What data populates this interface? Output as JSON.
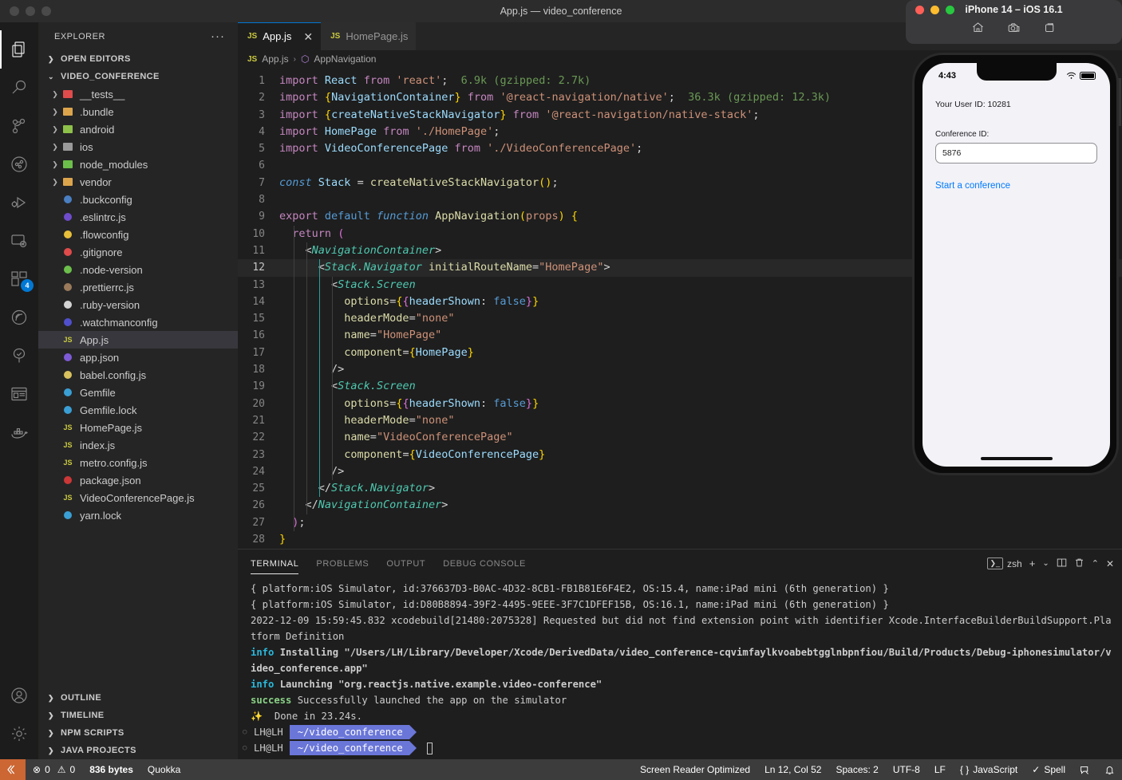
{
  "window": {
    "title": "App.js — video_conference"
  },
  "activity_bar": {
    "items": [
      {
        "name": "explorer",
        "icon": "files-icon",
        "active": true,
        "badge": null
      },
      {
        "name": "search",
        "icon": "search-icon",
        "active": false,
        "badge": null
      },
      {
        "name": "source-control",
        "icon": "source-control-icon",
        "active": false,
        "badge": null
      },
      {
        "name": "testing",
        "icon": "beaker-icon",
        "active": false,
        "badge": null
      },
      {
        "name": "run-and-debug",
        "icon": "run-debug-icon",
        "active": false,
        "badge": null
      },
      {
        "name": "remote-explorer",
        "icon": "remote-explorer-icon",
        "active": false,
        "badge": null
      },
      {
        "name": "extensions",
        "icon": "extensions-icon",
        "active": false,
        "badge": "4"
      },
      {
        "name": "sonarlint",
        "icon": "sonarlint-icon",
        "active": false,
        "badge": null
      },
      {
        "name": "test-tree",
        "icon": "tree-check-icon",
        "active": false,
        "badge": null
      },
      {
        "name": "browser-preview",
        "icon": "browser-preview-icon",
        "active": false,
        "badge": null
      },
      {
        "name": "docker",
        "icon": "docker-whale-icon",
        "active": false,
        "badge": null
      }
    ],
    "bottom_items": [
      {
        "name": "accounts",
        "icon": "account-icon"
      },
      {
        "name": "settings",
        "icon": "gear-icon"
      }
    ]
  },
  "sidebar": {
    "header": "EXPLORER",
    "more_actions": "···",
    "sections": [
      {
        "label": "OPEN EDITORS",
        "expanded": false
      },
      {
        "label": "VIDEO_CONFERENCE",
        "expanded": true
      }
    ],
    "tree": [
      {
        "label": "__tests__",
        "type": "folder",
        "icon_color": "#e04b4b",
        "expandable": true,
        "selected": false
      },
      {
        "label": ".bundle",
        "type": "folder",
        "icon_color": "#dca54c",
        "expandable": true,
        "selected": false
      },
      {
        "label": "android",
        "type": "folder",
        "icon_color": "#8dc149",
        "expandable": true,
        "selected": false
      },
      {
        "label": "ios",
        "type": "folder",
        "icon_color": "#9a9a9a",
        "expandable": true,
        "selected": false
      },
      {
        "label": "node_modules",
        "type": "folder",
        "icon_color": "#6cbf4b",
        "expandable": true,
        "selected": false
      },
      {
        "label": "vendor",
        "type": "folder",
        "icon_color": "#dca54c",
        "expandable": true,
        "selected": false
      },
      {
        "label": ".buckconfig",
        "type": "file",
        "icon_color": "#4a7fc1",
        "expandable": false,
        "selected": false
      },
      {
        "label": ".eslintrc.js",
        "type": "file",
        "icon_color": "#6f4ccc",
        "expandable": false,
        "selected": false
      },
      {
        "label": ".flowconfig",
        "type": "file",
        "icon_color": "#e8bf3a",
        "expandable": false,
        "selected": false
      },
      {
        "label": ".gitignore",
        "type": "file",
        "icon_color": "#e04b4b",
        "expandable": false,
        "selected": false
      },
      {
        "label": ".node-version",
        "type": "file",
        "icon_color": "#6cbf4b",
        "expandable": false,
        "selected": false
      },
      {
        "label": ".prettierrc.js",
        "type": "file",
        "icon_color": "#9a7a5a",
        "expandable": false,
        "selected": false
      },
      {
        "label": ".ruby-version",
        "type": "file",
        "icon_color": "#d4d4d4",
        "expandable": false,
        "selected": false
      },
      {
        "label": ".watchmanconfig",
        "type": "file",
        "icon_color": "#5050cc",
        "expandable": false,
        "selected": false
      },
      {
        "label": "App.js",
        "type": "js",
        "icon_color": "#cbcb41",
        "expandable": false,
        "selected": true
      },
      {
        "label": "app.json",
        "type": "file",
        "icon_color": "#7e5bd6",
        "expandable": false,
        "selected": false
      },
      {
        "label": "babel.config.js",
        "type": "file",
        "icon_color": "#d8c15e",
        "expandable": false,
        "selected": false
      },
      {
        "label": "Gemfile",
        "type": "file",
        "icon_color": "#3a9fd4",
        "expandable": false,
        "selected": false
      },
      {
        "label": "Gemfile.lock",
        "type": "file",
        "icon_color": "#3a9fd4",
        "expandable": false,
        "selected": false
      },
      {
        "label": "HomePage.js",
        "type": "js",
        "icon_color": "#cbcb41",
        "expandable": false,
        "selected": false
      },
      {
        "label": "index.js",
        "type": "js",
        "icon_color": "#cbcb41",
        "expandable": false,
        "selected": false
      },
      {
        "label": "metro.config.js",
        "type": "js",
        "icon_color": "#cbcb41",
        "expandable": false,
        "selected": false
      },
      {
        "label": "package.json",
        "type": "file",
        "icon_color": "#cb3837",
        "expandable": false,
        "selected": false
      },
      {
        "label": "VideoConferencePage.js",
        "type": "js",
        "icon_color": "#cbcb41",
        "expandable": false,
        "selected": false
      },
      {
        "label": "yarn.lock",
        "type": "file",
        "icon_color": "#3a9fd4",
        "expandable": false,
        "selected": false
      }
    ],
    "bottom_sections": [
      {
        "label": "OUTLINE"
      },
      {
        "label": "TIMELINE"
      },
      {
        "label": "NPM SCRIPTS"
      },
      {
        "label": "JAVA PROJECTS"
      }
    ]
  },
  "editor": {
    "tabs": [
      {
        "label": "App.js",
        "active": true,
        "badge": "JS",
        "closable": true
      },
      {
        "label": "HomePage.js",
        "active": false,
        "badge": "JS",
        "closable": false
      }
    ],
    "close_glyph": "✕",
    "breadcrumb": {
      "file_badge": "JS",
      "file": "App.js",
      "separator": "›",
      "symbol": "AppNavigation"
    },
    "total_lines": 28,
    "current_line": 12,
    "code_lines": [
      {
        "n": 1,
        "html": "<span class='k'>import</span> <span class='id'>React</span> <span class='k'>from</span> <span class='str'>'react'</span><span class='pun'>;</span>  <span class='ann'>6.9k (gzipped: 2.7k)</span>"
      },
      {
        "n": 2,
        "html": "<span class='k'>import</span> <span class='br1'>{</span><span class='id'>NavigationContainer</span><span class='br1'>}</span> <span class='k'>from</span> <span class='str'>'@react-navigation/native'</span><span class='pun'>;</span>  <span class='ann'>36.3k (gzipped: 12.3k)</span>"
      },
      {
        "n": 3,
        "html": "<span class='k'>import</span> <span class='br1'>{</span><span class='id'>createNativeStackNavigator</span><span class='br1'>}</span> <span class='k'>from</span> <span class='str'>'@react-navigation/native-stack'</span><span class='pun'>;</span>"
      },
      {
        "n": 4,
        "html": "<span class='k'>import</span> <span class='id'>HomePage</span> <span class='k'>from</span> <span class='str'>'./HomePage'</span><span class='pun'>;</span>"
      },
      {
        "n": 5,
        "html": "<span class='k'>import</span> <span class='id'>VideoConferencePage</span> <span class='k'>from</span> <span class='str'>'./VideoConferencePage'</span><span class='pun'>;</span>"
      },
      {
        "n": 6,
        "html": ""
      },
      {
        "n": 7,
        "html": "<span class='kwi'>const</span> <span class='id'>Stack</span> <span class='pun'>=</span> <span class='fn'>createNativeStackNavigator</span><span class='br1'>()</span><span class='pun'>;</span>"
      },
      {
        "n": 8,
        "html": ""
      },
      {
        "n": 9,
        "html": "<span class='k'>export</span> <span class='kw'>default</span> <span class='kwi'>function</span> <span class='fn'>AppNavigation</span><span class='br1'>(</span><span class='str'>props</span><span class='br1'>)</span> <span class='br1'>{</span>"
      },
      {
        "n": 10,
        "html": "  <span class='k'>return</span> <span class='br2'>(</span>"
      },
      {
        "n": 11,
        "html": "    <span class='pun'>&lt;</span><span class='tag'>NavigationContainer</span><span class='pun'>&gt;</span>"
      },
      {
        "n": 12,
        "html": "      <span class='pun'>&lt;</span><span class='tag'>Stack.Navigator</span> <span class='prop'>initialRouteName</span><span class='pun'>=</span><span class='str'>\"HomePage\"</span><span class='pun'>&gt;</span>"
      },
      {
        "n": 13,
        "html": "        <span class='pun'>&lt;</span><span class='tag'>Stack.Screen</span>"
      },
      {
        "n": 14,
        "html": "          <span class='prop'>options</span><span class='pun'>=</span><span class='br1'>{</span><span class='br2'>{</span><span class='id'>headerShown</span><span class='pun'>: </span><span class='lit'>false</span><span class='br2'>}</span><span class='br1'>}</span>"
      },
      {
        "n": 15,
        "html": "          <span class='prop'>headerMode</span><span class='pun'>=</span><span class='str'>\"none\"</span>"
      },
      {
        "n": 16,
        "html": "          <span class='prop'>name</span><span class='pun'>=</span><span class='str'>\"HomePage\"</span>"
      },
      {
        "n": 17,
        "html": "          <span class='prop'>component</span><span class='pun'>=</span><span class='br1'>{</span><span class='id'>HomePage</span><span class='br1'>}</span>"
      },
      {
        "n": 18,
        "html": "        <span class='pun'>/&gt;</span>"
      },
      {
        "n": 19,
        "html": "        <span class='pun'>&lt;</span><span class='tag'>Stack.Screen</span>"
      },
      {
        "n": 20,
        "html": "          <span class='prop'>options</span><span class='pun'>=</span><span class='br1'>{</span><span class='br2'>{</span><span class='id'>headerShown</span><span class='pun'>: </span><span class='lit'>false</span><span class='br2'>}</span><span class='br1'>}</span>"
      },
      {
        "n": 21,
        "html": "          <span class='prop'>headerMode</span><span class='pun'>=</span><span class='str'>\"none\"</span>"
      },
      {
        "n": 22,
        "html": "          <span class='prop'>name</span><span class='pun'>=</span><span class='str'>\"VideoConferencePage\"</span>"
      },
      {
        "n": 23,
        "html": "          <span class='prop'>component</span><span class='pun'>=</span><span class='br1'>{</span><span class='id'>VideoConferencePage</span><span class='br1'>}</span>"
      },
      {
        "n": 24,
        "html": "        <span class='pun'>/&gt;</span>"
      },
      {
        "n": 25,
        "html": "      <span class='pun'>&lt;/</span><span class='tag'>Stack.Navigator</span><span class='pun'>&gt;</span>"
      },
      {
        "n": 26,
        "html": "    <span class='pun'>&lt;/</span><span class='tag'>NavigationContainer</span><span class='pun'>&gt;</span>"
      },
      {
        "n": 27,
        "html": "  <span class='br2'>)</span><span class='pun'>;</span>"
      },
      {
        "n": 28,
        "html": "<span class='br1'>}</span>"
      }
    ]
  },
  "panel": {
    "tabs": [
      {
        "label": "TERMINAL",
        "active": true
      },
      {
        "label": "PROBLEMS",
        "active": false
      },
      {
        "label": "OUTPUT",
        "active": false
      },
      {
        "label": "DEBUG CONSOLE",
        "active": false
      }
    ],
    "shell": "zsh",
    "actions": [
      {
        "name": "new-terminal-button",
        "glyph": "+"
      },
      {
        "name": "terminal-dropdown-button",
        "glyph": "⌄"
      },
      {
        "name": "split-terminal-button",
        "glyph": "▯▯"
      },
      {
        "name": "kill-terminal-button",
        "glyph": "🗑"
      },
      {
        "name": "maximize-panel-button",
        "glyph": "⌃"
      },
      {
        "name": "close-panel-button",
        "glyph": "✕"
      }
    ],
    "terminal_lines": [
      {
        "segments": [
          {
            "text": "{ platform:iOS Simulator, id:376637D3-B0AC-4D32-8CB1-FB1B81E6F4E2, OS:15.4, name:iPad mini (6th generation) }",
            "style": "plain"
          }
        ]
      },
      {
        "segments": [
          {
            "text": "{ platform:iOS Simulator, id:D80B8894-39F2-4495-9EEE-3F7C1DFEF15B, OS:16.1, name:iPad mini (6th generation) }",
            "style": "plain"
          }
        ]
      },
      {
        "segments": [
          {
            "text": "2022-12-09 15:59:45.832 xcodebuild[21480:2075328] Requested but did not find extension point with identifier Xcode.InterfaceBuilderBuildSupport.Platform Definition",
            "style": "plain"
          }
        ]
      },
      {
        "segments": [
          {
            "text": "info",
            "style": "info"
          },
          {
            "text": " Installing \"/Users/LH/Library/Developer/Xcode/DerivedData/video_conference-cqvimfaylkvoabebtgglnbpnfiou/Build/Products/Debug-iphonesimulator/video_conference.app\"",
            "style": "bold"
          }
        ]
      },
      {
        "segments": [
          {
            "text": "info",
            "style": "info"
          },
          {
            "text": " Launching \"org.reactjs.native.example.video-conference\"",
            "style": "bold"
          }
        ]
      },
      {
        "segments": [
          {
            "text": "success",
            "style": "success"
          },
          {
            "text": " Successfully launched the app on the simulator",
            "style": "plain"
          }
        ]
      },
      {
        "segments": [
          {
            "text": "✨",
            "style": "spark"
          },
          {
            "text": "  Done in 23.24s.",
            "style": "plain"
          }
        ]
      }
    ],
    "prompts": [
      {
        "user": "LH@LH",
        "path": "~/video_conference",
        "cursor": false
      },
      {
        "user": "LH@LH",
        "path": "~/video_conference",
        "cursor": true
      }
    ]
  },
  "status_bar": {
    "remote_icon": "remote-window-icon",
    "errors": "0",
    "warnings": "0",
    "file_size": "836 bytes",
    "quokka": "Quokka",
    "screen_reader": "Screen Reader Optimized",
    "cursor_position": "Ln 12, Col 52",
    "indentation": "Spaces: 2",
    "encoding": "UTF-8",
    "eol": "LF",
    "language": "JavaScript",
    "spell": "Spell",
    "accent": "#cc6633"
  },
  "simulator": {
    "title": "iPhone 14 – iOS 16.1",
    "traffic_lights": [
      "#ff5f57",
      "#febc2e",
      "#28c840"
    ],
    "toolbar": [
      {
        "name": "home-button",
        "icon": "home-icon"
      },
      {
        "name": "screenshot-button",
        "icon": "camera-icon"
      },
      {
        "name": "record-button",
        "icon": "record-icon"
      }
    ],
    "status": {
      "time": "4:43",
      "wifi": "wifi-icon",
      "battery": "battery-icon"
    },
    "app": {
      "user_id_label": "Your User ID: 10281",
      "conference_id_label": "Conference ID:",
      "conference_id_value": "5876",
      "start_link": "Start a conference",
      "link_color": "#007aff"
    }
  }
}
